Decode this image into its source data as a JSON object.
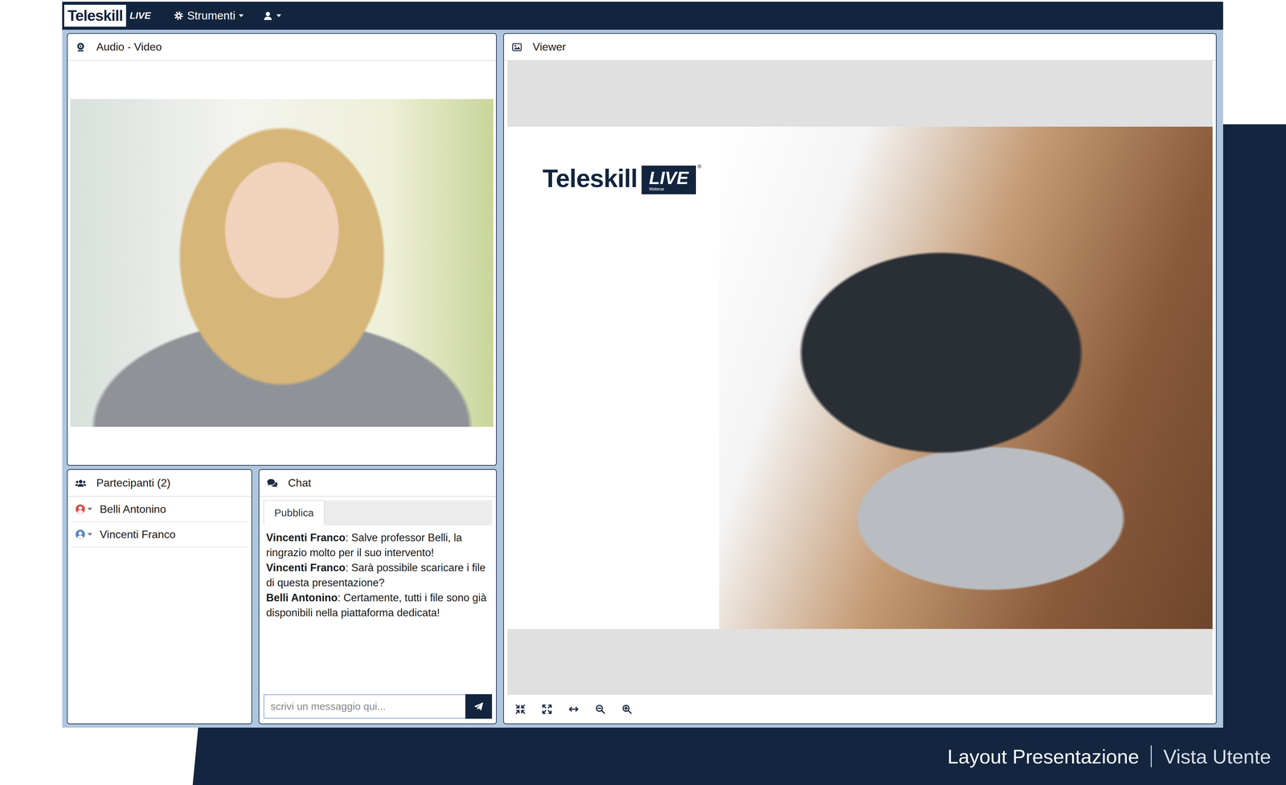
{
  "topbar": {
    "logo": "Teleskill",
    "logo_badge": "LIVE",
    "tools_menu": "Strumenti"
  },
  "audio_video": {
    "title": "Audio - Video"
  },
  "participants": {
    "title": "Partecipanti (2)",
    "items": [
      {
        "name": "Belli Antonino",
        "color": "#d9534f"
      },
      {
        "name": "Vincenti Franco",
        "color": "#5b8ac4"
      }
    ]
  },
  "chat": {
    "title": "Chat",
    "tabs": [
      {
        "label": "Pubblica",
        "selected": true
      }
    ],
    "messages": [
      {
        "author": "Vincenti Franco",
        "text": ": Salve professor Belli, la ringrazio molto per il suo intervento!"
      },
      {
        "author": "Vincenti Franco",
        "text": ": Sarà possibile scaricare i file di questa presentazione?"
      },
      {
        "author": "Belli Antonino",
        "text": ": Certamente, tutti i file sono già disponibili nella piattaforma dedicata!"
      }
    ],
    "input": {
      "placeholder": "scrivi un messaggio qui..."
    }
  },
  "viewer": {
    "title": "Viewer",
    "slide": {
      "logo": "Teleskill",
      "badge": "LIVE",
      "badge_sub": "Webinar",
      "mark": "®"
    }
  },
  "caption": {
    "title": "Layout Presentazione",
    "subtitle": "Vista Utente"
  }
}
